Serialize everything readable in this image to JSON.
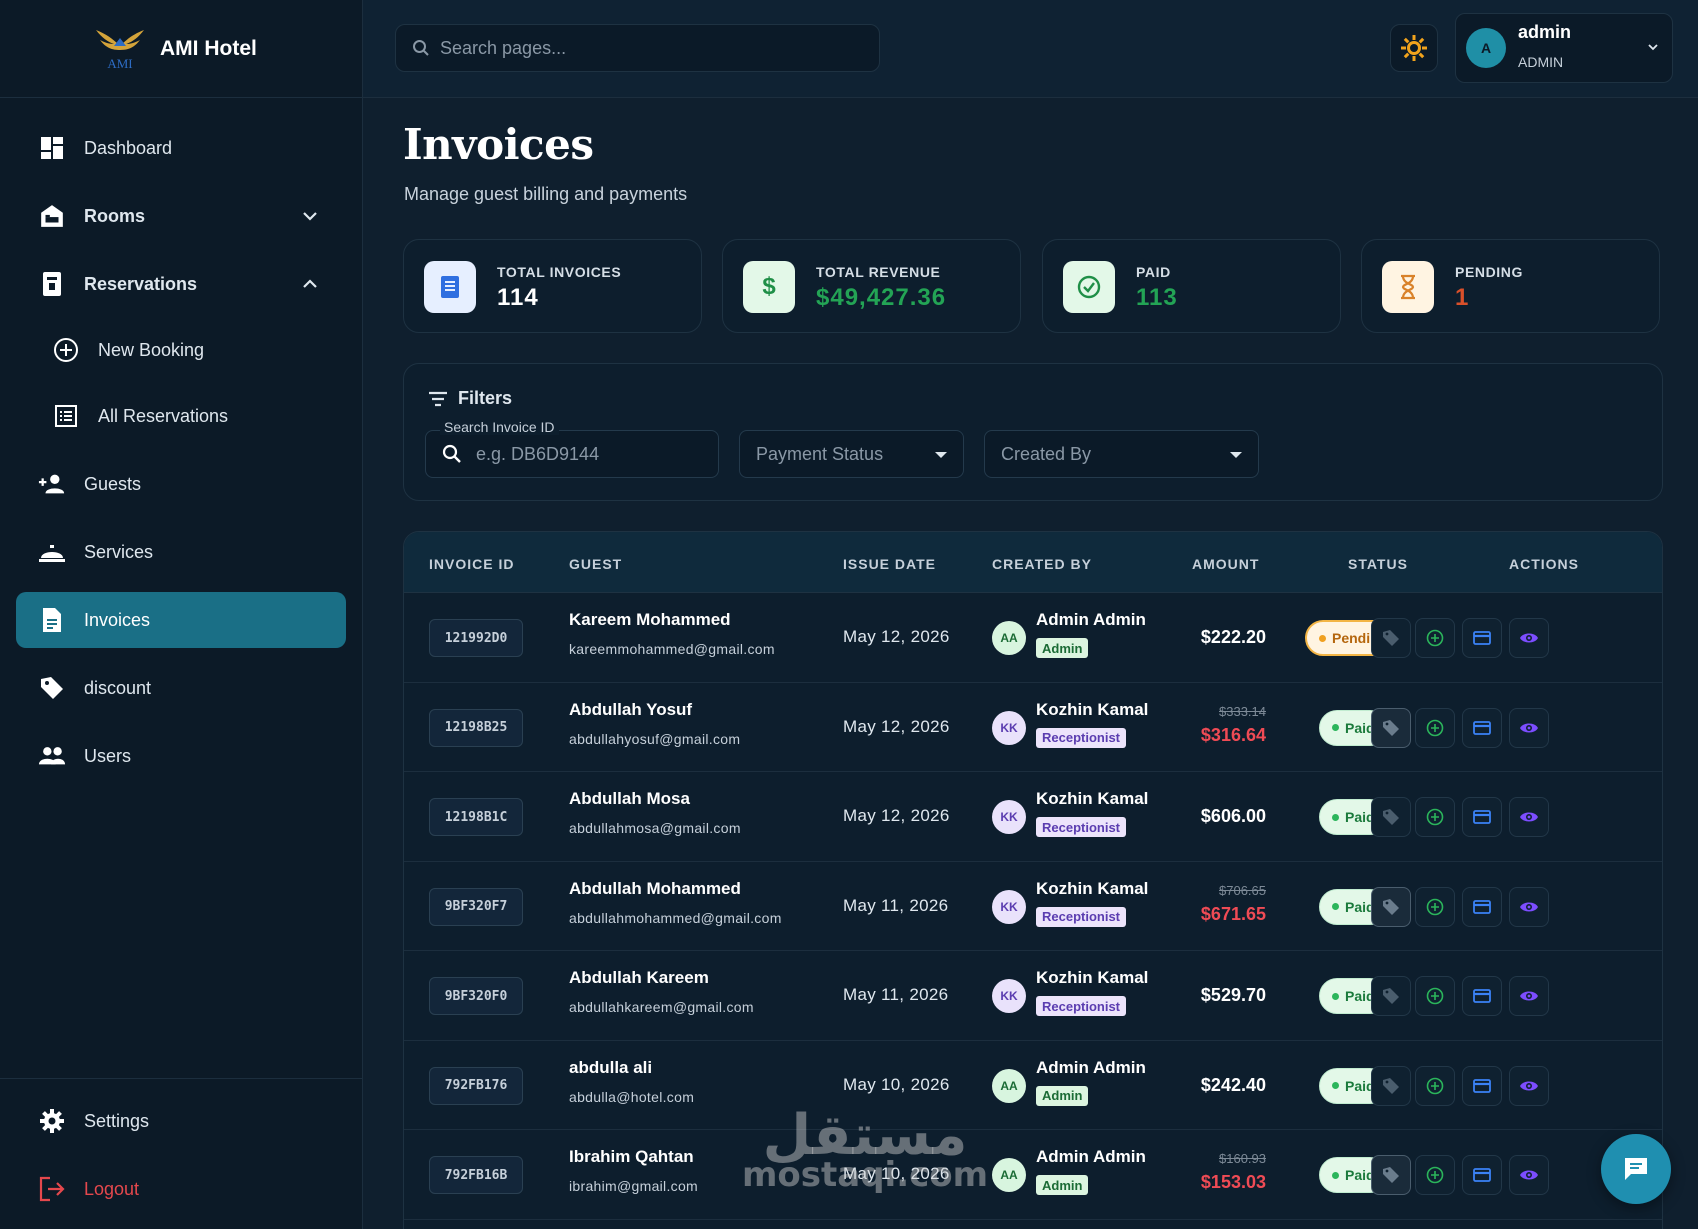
{
  "brand": {
    "name": "AMI Hotel"
  },
  "sidebar": {
    "items": [
      {
        "key": "dashboard",
        "label": "Dashboard",
        "icon": "dashboard-icon"
      },
      {
        "key": "rooms",
        "label": "Rooms",
        "icon": "bed-icon",
        "expandable": true,
        "expanded": false
      },
      {
        "key": "reservations",
        "label": "Reservations",
        "icon": "receipt-icon",
        "expandable": true,
        "expanded": true
      },
      {
        "key": "new-booking",
        "label": "New Booking",
        "icon": "plus-circle-icon",
        "sub": true
      },
      {
        "key": "all-reservations",
        "label": "All Reservations",
        "icon": "list-icon",
        "sub": true
      },
      {
        "key": "guests",
        "label": "Guests",
        "icon": "person-add-icon"
      },
      {
        "key": "services",
        "label": "Services",
        "icon": "room-service-icon"
      },
      {
        "key": "invoices",
        "label": "Invoices",
        "icon": "document-icon",
        "active": true
      },
      {
        "key": "discount",
        "label": "discount",
        "icon": "tag-icon"
      },
      {
        "key": "users",
        "label": "Users",
        "icon": "people-icon"
      }
    ],
    "bottom": {
      "settings_label": "Settings",
      "logout_label": "Logout"
    }
  },
  "topbar": {
    "search_placeholder": "Search pages...",
    "user": {
      "initial": "A",
      "name": "admin",
      "role": "ADMIN"
    }
  },
  "page": {
    "title": "Invoices",
    "subtitle": "Manage guest billing and payments"
  },
  "stats": [
    {
      "label": "TOTAL INVOICES",
      "value": "114",
      "color": "#ffffff",
      "icon": "receipt-icon",
      "icon_bg": "#e6efff",
      "icon_color": "#2f6fe0"
    },
    {
      "label": "TOTAL REVENUE",
      "value": "$49,427.36",
      "color": "#23a455",
      "icon": "dollar-icon",
      "icon_bg": "#e3f8e8",
      "icon_color": "#1f8f47"
    },
    {
      "label": "PAID",
      "value": "113",
      "color": "#23a455",
      "icon": "check-circle-icon",
      "icon_bg": "#e3f8e8",
      "icon_color": "#1f8f47"
    },
    {
      "label": "PENDING",
      "value": "1",
      "color": "#d9502a",
      "icon": "hourglass-icon",
      "icon_bg": "#fff4e2",
      "icon_color": "#d9822a"
    }
  ],
  "filters": {
    "title": "Filters",
    "invoice_id_label": "Search Invoice ID",
    "invoice_id_placeholder": "e.g. DB6D9144",
    "payment_status_placeholder": "Payment Status",
    "created_by_placeholder": "Created By"
  },
  "table": {
    "columns": [
      "INVOICE ID",
      "GUEST",
      "ISSUE DATE",
      "CREATED BY",
      "AMOUNT",
      "STATUS",
      "ACTIONS"
    ],
    "rows": [
      {
        "id": "121992D0",
        "guest": "Kareem Mohammed",
        "email": "kareemmohammed@gmail.com",
        "date": "May 12, 2026",
        "initials": "AA",
        "creator": "Admin Admin",
        "role": "Admin",
        "amount": "$222.20",
        "old_amount": "",
        "status": "Pending",
        "tag_active": false
      },
      {
        "id": "12198B25",
        "guest": "Abdullah Yosuf",
        "email": "abdullahyosuf@gmail.com",
        "date": "May 12, 2026",
        "initials": "KK",
        "creator": "Kozhin Kamal",
        "role": "Receptionist",
        "amount": "$316.64",
        "old_amount": "$333.14",
        "status": "Paid",
        "tag_active": true
      },
      {
        "id": "12198B1C",
        "guest": "Abdullah Mosa",
        "email": "abdullahmosa@gmail.com",
        "date": "May 12, 2026",
        "initials": "KK",
        "creator": "Kozhin Kamal",
        "role": "Receptionist",
        "amount": "$606.00",
        "old_amount": "",
        "status": "Paid",
        "tag_active": false
      },
      {
        "id": "9BF320F7",
        "guest": "Abdullah Mohammed",
        "email": "abdullahmohammed@gmail.com",
        "date": "May 11, 2026",
        "initials": "KK",
        "creator": "Kozhin Kamal",
        "role": "Receptionist",
        "amount": "$671.65",
        "old_amount": "$706.65",
        "status": "Paid",
        "tag_active": true
      },
      {
        "id": "9BF320F0",
        "guest": "Abdullah Kareem",
        "email": "abdullahkareem@gmail.com",
        "date": "May 11, 2026",
        "initials": "KK",
        "creator": "Kozhin Kamal",
        "role": "Receptionist",
        "amount": "$529.70",
        "old_amount": "",
        "status": "Paid",
        "tag_active": false
      },
      {
        "id": "792FB176",
        "guest": "abdulla ali",
        "email": "abdulla@hotel.com",
        "date": "May 10, 2026",
        "initials": "AA",
        "creator": "Admin Admin",
        "role": "Admin",
        "amount": "$242.40",
        "old_amount": "",
        "status": "Paid",
        "tag_active": false
      },
      {
        "id": "792FB16B",
        "guest": "Ibrahim Qahtan",
        "email": "ibrahim@gmail.com",
        "date": "May 10, 2026",
        "initials": "AA",
        "creator": "Admin Admin",
        "role": "Admin",
        "amount": "$153.03",
        "old_amount": "$160.93",
        "status": "Paid",
        "tag_active": true
      }
    ]
  },
  "watermark": {
    "arabic": "مستقل",
    "latin": "mostaqi.com"
  },
  "colors": {
    "accent": "#1a6f86",
    "background": "#0f1f2e",
    "danger": "#ef4b55",
    "success": "#23a455"
  }
}
